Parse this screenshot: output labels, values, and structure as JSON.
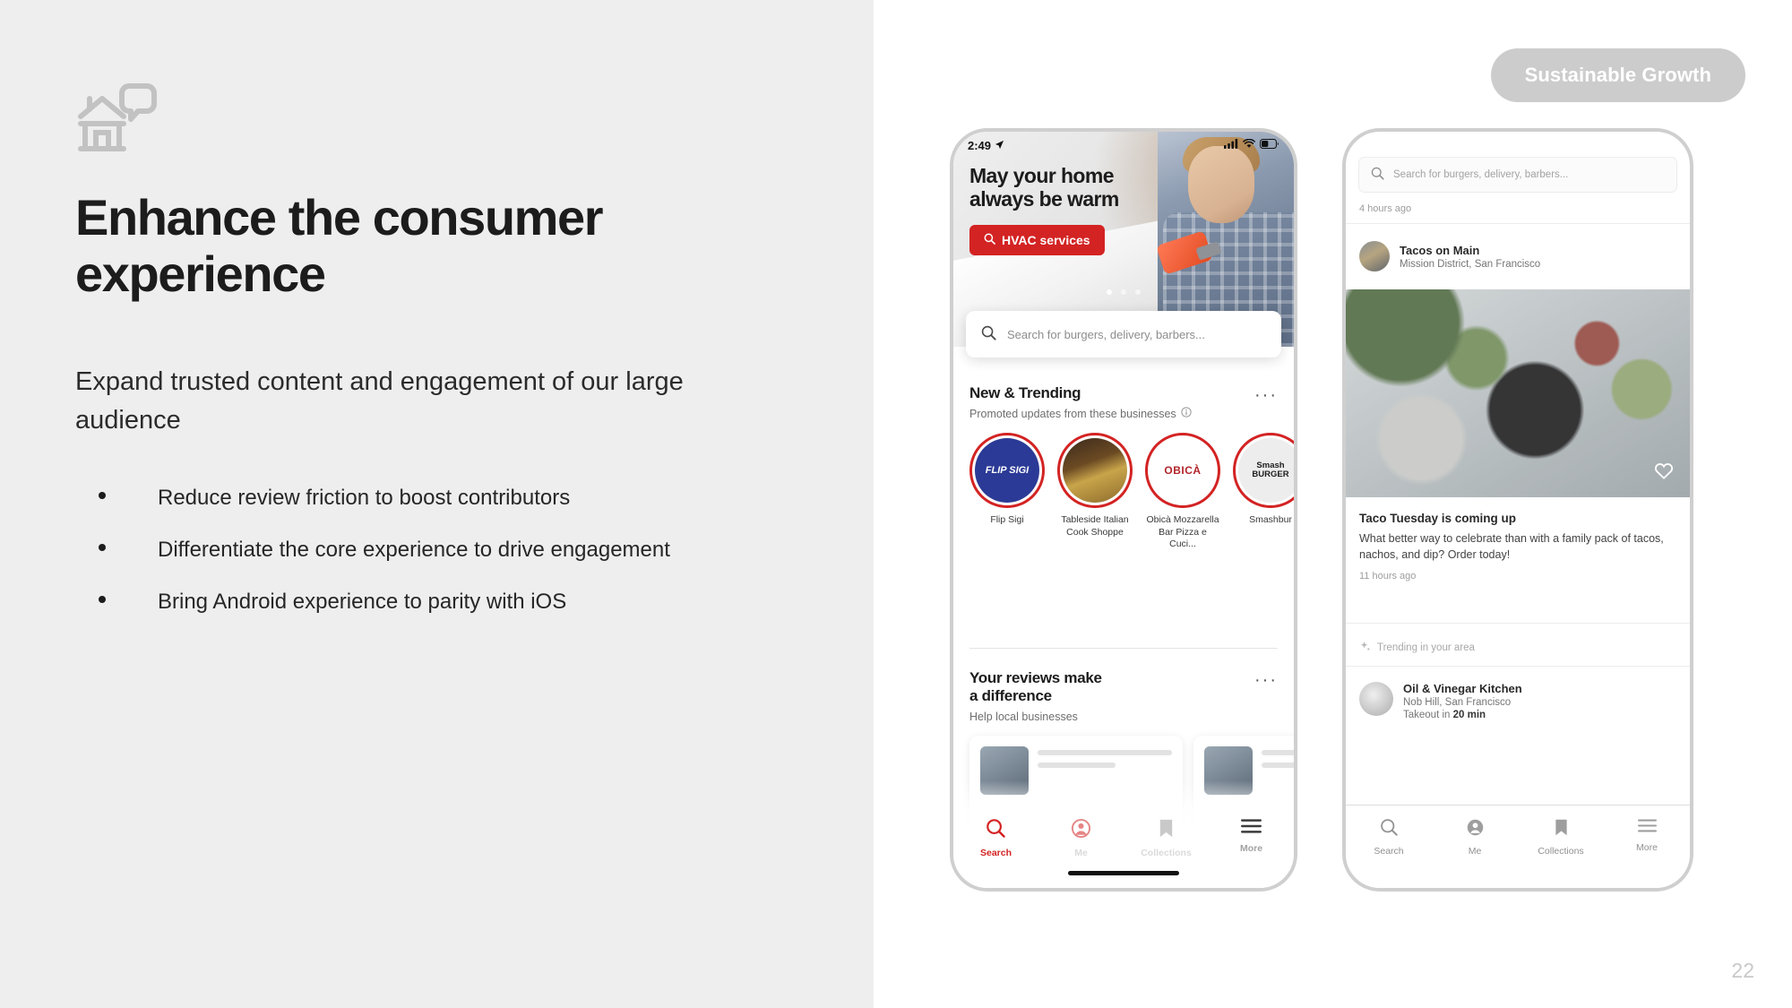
{
  "slide": {
    "icon": "storefront-chat-icon",
    "title": "Enhance the consumer experience",
    "subtitle": "Expand trusted content and engagement of our large audience",
    "bullets": [
      "Reduce review friction to boost contributors",
      "Differentiate the core experience to drive engagement",
      "Bring Android experience to parity with iOS"
    ],
    "badge": "Sustainable Growth",
    "page_number": "22",
    "colors": {
      "left_panel_bg": "#eeeeee",
      "title": "#1c1c1c",
      "badge_bg": "#cccccc",
      "brand_red": "#d32323"
    }
  },
  "phone_1": {
    "status_bar": {
      "time": "2:49",
      "location_icon": "location-arrow-icon",
      "signal_icon": "cellular-signal-icon",
      "wifi_icon": "wifi-icon",
      "battery_icon": "battery-icon"
    },
    "hero": {
      "headline_line_1": "May your home",
      "headline_line_2": "always be warm",
      "cta_label": "HVAC services",
      "cta_icon": "search-icon",
      "carousel_dots": 3,
      "active_dot": 1
    },
    "search": {
      "placeholder": "Search for burgers, delivery, barbers...",
      "icon": "search-icon"
    },
    "trending": {
      "title": "New & Trending",
      "subtitle": "Promoted updates from these businesses",
      "info_icon": "info-circle-icon",
      "menu_icon": "overflow-menu-icon",
      "businesses": [
        {
          "name": "Flip Sigi",
          "logo_text": "FLIP SIGI"
        },
        {
          "name": "Tableside Italian Cook Shoppe",
          "logo_text": ""
        },
        {
          "name": "Obicà Mozzarella Bar Pizza e Cuci...",
          "logo_text": "OBICÀ"
        },
        {
          "name": "Smashbur",
          "logo_text": "Smash BURGER"
        }
      ]
    },
    "reviews": {
      "title_line_1": "Your reviews make",
      "title_line_2": "a difference",
      "subtitle": "Help local businesses",
      "menu_icon": "overflow-menu-icon"
    },
    "tabbar": [
      {
        "label": "Search",
        "icon": "search-icon",
        "state": "active"
      },
      {
        "label": "Me",
        "icon": "person-icon",
        "state": "faded"
      },
      {
        "label": "Collections",
        "icon": "bookmark-icon",
        "state": "faded"
      },
      {
        "label": "More",
        "icon": "hamburger-menu-icon",
        "state": "faded"
      }
    ]
  },
  "phone_2": {
    "search": {
      "placeholder": "Search for burgers, delivery, barbers...",
      "icon": "search-icon"
    },
    "feed_time": "4 hours ago",
    "business": {
      "name": "Tacos on Main",
      "location": "Mission District, San Francisco",
      "avatar": "taco-bowl-avatar"
    },
    "photo_like_icon": "heart-icon",
    "post": {
      "title": "Taco Tuesday is coming up",
      "body": "What better way to celebrate than with a family pack of tacos, nachos, and dip? Order today!",
      "time": "11 hours ago"
    },
    "trending_label": "Trending in your area",
    "trending_icon": "sparkle-icon",
    "business_2": {
      "name": "Oil & Vinegar Kitchen",
      "location": "Nob Hill, San Francisco",
      "takeout_prefix": "Takeout in ",
      "takeout_time": "20 min",
      "avatar": "oil-bottle-avatar"
    },
    "tabbar": [
      {
        "label": "Search",
        "icon": "search-icon"
      },
      {
        "label": "Me",
        "icon": "person-icon"
      },
      {
        "label": "Collections",
        "icon": "bookmark-icon"
      },
      {
        "label": "More",
        "icon": "hamburger-menu-icon"
      }
    ]
  }
}
